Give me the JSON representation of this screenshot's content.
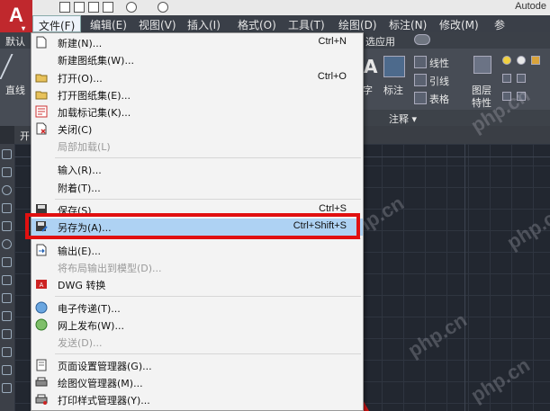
{
  "app": {
    "logo": "A",
    "logo_suffix": "▾",
    "title": "Autode"
  },
  "menu": {
    "items": [
      "文件(F)",
      "编辑(E)",
      "视图(V)",
      "插入(I)",
      "格式(O)",
      "工具(T)",
      "绘图(D)",
      "标注(N)",
      "修改(M)",
      "参"
    ]
  },
  "ribbon": {
    "tab_default": "默认",
    "line_label": "直线",
    "app_label": "选应用",
    "text_label": "字",
    "dim_label": "标注",
    "linear_label": "线性",
    "leader_label": "引线",
    "table_label": "表格",
    "layer_label": "图层",
    "props_label": "特性",
    "panel_annotate": "注释 ▾",
    "file_tab": "开"
  },
  "dropdown": {
    "items": [
      {
        "label": "新建(N)...",
        "shortcut": "Ctrl+N",
        "icon": "new-file-icon",
        "disabled": false
      },
      {
        "label": "新建图纸集(W)...",
        "shortcut": "",
        "icon": "",
        "disabled": false
      },
      {
        "label": "打开(O)...",
        "shortcut": "Ctrl+O",
        "icon": "open-folder-icon",
        "disabled": false
      },
      {
        "label": "打开图纸集(E)...",
        "shortcut": "",
        "icon": "open-sheetset-icon",
        "disabled": false
      },
      {
        "label": "加载标记集(K)...",
        "shortcut": "",
        "icon": "markup-icon",
        "disabled": false
      },
      {
        "label": "关闭(C)",
        "shortcut": "",
        "icon": "close-file-icon",
        "disabled": false
      },
      {
        "label": "局部加载(L)",
        "shortcut": "",
        "icon": "",
        "disabled": true
      },
      {
        "label": "输入(R)...",
        "shortcut": "",
        "icon": "",
        "disabled": false
      },
      {
        "label": "附着(T)...",
        "shortcut": "",
        "icon": "",
        "disabled": false
      },
      {
        "label": "保存(S)",
        "shortcut": "Ctrl+S",
        "icon": "save-icon",
        "disabled": false
      },
      {
        "label": "另存为(A)...",
        "shortcut": "Ctrl+Shift+S",
        "icon": "save-as-icon",
        "disabled": false
      },
      {
        "label": "输出(E)...",
        "shortcut": "",
        "icon": "export-icon",
        "disabled": false
      },
      {
        "label": "将布局输出到模型(D)...",
        "shortcut": "",
        "icon": "",
        "disabled": true
      },
      {
        "label": "DWG 转换",
        "shortcut": "",
        "icon": "dwg-convert-icon",
        "disabled": false
      },
      {
        "label": "电子传递(T)...",
        "shortcut": "",
        "icon": "etransmit-icon",
        "disabled": false
      },
      {
        "label": "网上发布(W)...",
        "shortcut": "",
        "icon": "publish-web-icon",
        "disabled": false
      },
      {
        "label": "发送(D)...",
        "shortcut": "",
        "icon": "",
        "disabled": true
      },
      {
        "label": "页面设置管理器(G)...",
        "shortcut": "",
        "icon": "page-setup-icon",
        "disabled": false
      },
      {
        "label": "绘图仪管理器(M)...",
        "shortcut": "",
        "icon": "plotter-icon",
        "disabled": false
      },
      {
        "label": "打印样式管理器(Y)...",
        "shortcut": "",
        "icon": "plot-style-icon",
        "disabled": false
      }
    ]
  },
  "watermark": "php.cn",
  "colors": {
    "highlight": "#aed2f3",
    "annotation_red": "#e11010",
    "logo_red": "#c0282d"
  }
}
